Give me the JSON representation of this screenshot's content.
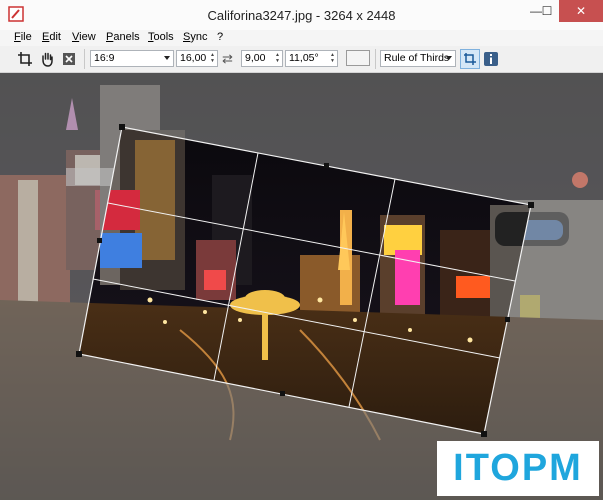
{
  "window": {
    "title": "Califorina3247.jpg - 3264 x 2448",
    "minimize_glyph": "—",
    "maximize_glyph": "☐",
    "close_glyph": "✕"
  },
  "menu": {
    "items": [
      "File",
      "Edit",
      "View",
      "Panels",
      "Tools",
      "Sync",
      "?"
    ]
  },
  "toolbar": {
    "aspect_ratio": "16:9",
    "ratio_width": "16,00",
    "swap_glyph": "⇄",
    "ratio_height": "9,00",
    "rotation": "11,05°",
    "guide_overlay": "Rule of Thirds"
  },
  "icons": {
    "crop": "crop-icon",
    "pan": "hand-icon",
    "cancel": "close-icon",
    "swap": "swap-icon",
    "crop_tool": "crop-tool-icon",
    "info": "info-icon"
  },
  "colors": {
    "close_button": "#c75050",
    "selection_handle": "#111111",
    "watermark": "#1fa6dd"
  },
  "watermark": {
    "text": "ITOPM"
  }
}
